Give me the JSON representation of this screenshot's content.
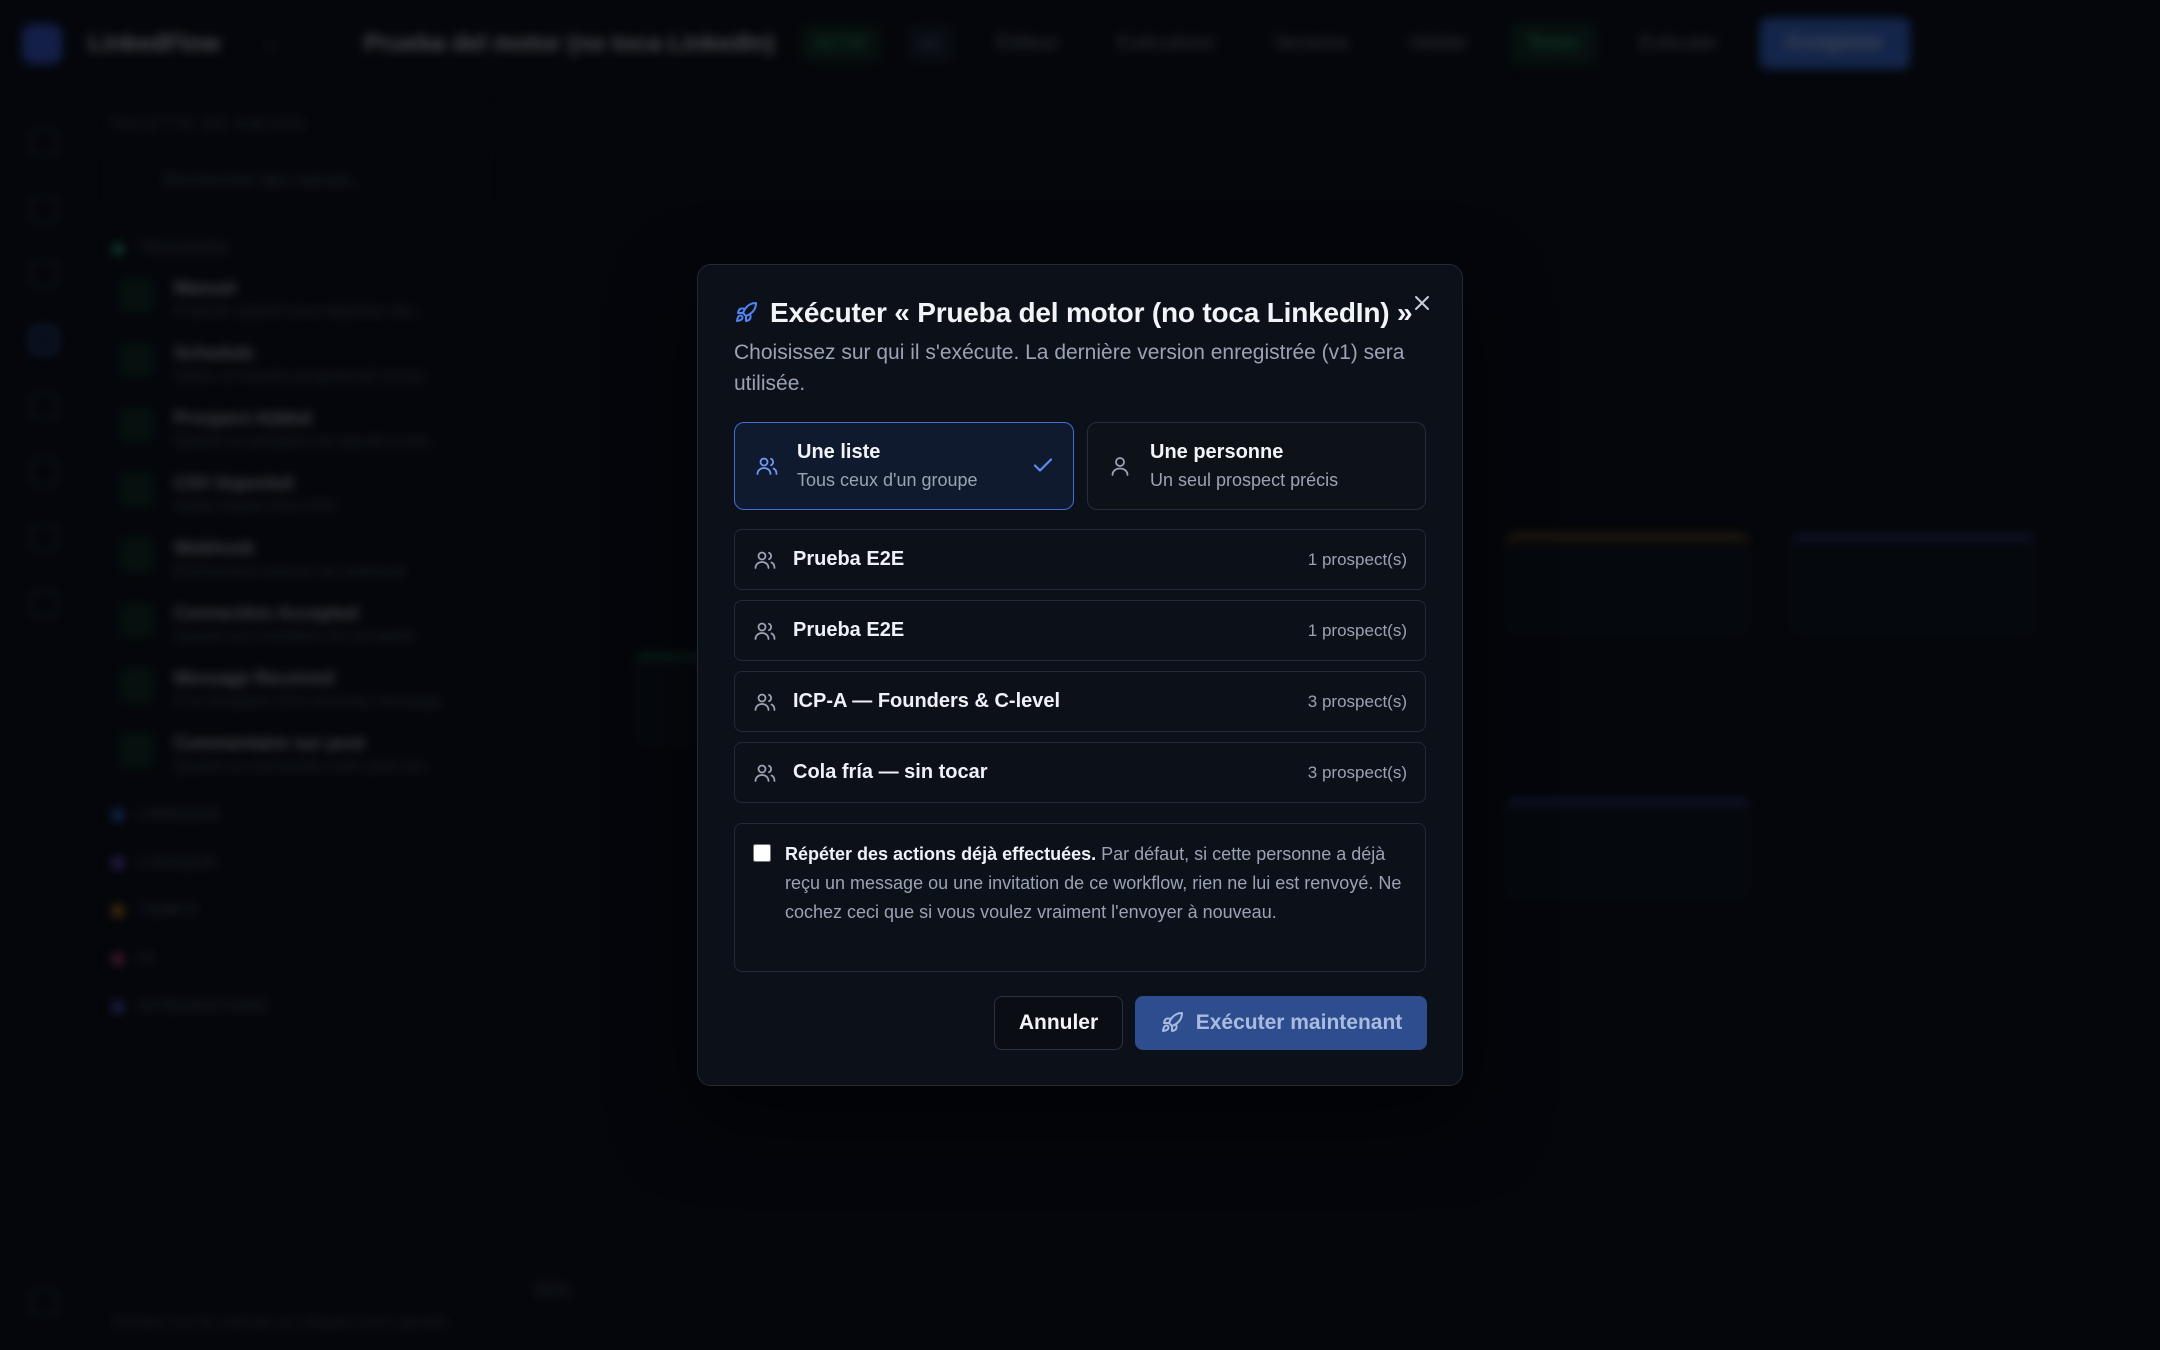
{
  "app": {
    "brand": "LinkedFlow",
    "workflow_title": "Prueba del motor (no toca LinkedIn)",
    "status_badge": "ACTIF",
    "version_badge": "v1",
    "toolbar": [
      "Éditeur",
      "Exécutions",
      "Versions",
      "Valider",
      "Tester",
      "Exécuter",
      "Enregistrer"
    ],
    "palette_heading": "PALETTE DE NŒUDS",
    "palette_search_placeholder": "Rechercher des nœuds...",
    "palette_categories": [
      {
        "label": "TRIGGERS",
        "color": "#2fbf71"
      },
      {
        "label": "LINKEDIN",
        "color": "#3b82f6"
      },
      {
        "label": "LOGIQUE",
        "color": "#8b5cf6"
      },
      {
        "label": "TEMPS",
        "color": "#f59e0b"
      },
      {
        "label": "IA",
        "color": "#ec4899"
      },
      {
        "label": "INTÉGRATIONS",
        "color": "#6366f1"
      }
    ],
    "trigger_nodes": [
      {
        "title": "Manuel",
        "desc": "À lancer quand vous déposez des..."
      },
      {
        "title": "Schedule",
        "desc": "Selon un horaire programmé (cron)"
      },
      {
        "title": "Prospect Added",
        "desc": "Quand un prospect est ajouté à une..."
      },
      {
        "title": "CSV Imported",
        "desc": "Après import d'un CSV"
      },
      {
        "title": "Webhook",
        "desc": "Événement externe via webhook"
      },
      {
        "title": "Connection Accepted",
        "desc": "Quand une invitation est acceptée"
      },
      {
        "title": "Message Received",
        "desc": "À la réception d'un nouveau message"
      },
      {
        "title": "Commentaire sur post",
        "desc": "Quand un commente votre post sur..."
      }
    ],
    "canvas_zoom": "60%",
    "canvas_hint": "Glissez sur le canvas ou cliquez pour ajouter"
  },
  "modal": {
    "title": "Exécuter « Prueba del motor (no toca LinkedIn) »",
    "subtitle": "Choisissez sur qui il s'exécute. La dernière version enregistrée (v1) sera utilisée.",
    "target_options": [
      {
        "title": "Une liste",
        "desc": "Tous ceux d'un groupe",
        "selected": true
      },
      {
        "title": "Une personne",
        "desc": "Un seul prospect précis",
        "selected": false
      }
    ],
    "lists": [
      {
        "name": "Prueba E2E",
        "count": "1 prospect(s)"
      },
      {
        "name": "Prueba E2E",
        "count": "1 prospect(s)"
      },
      {
        "name": "ICP-A — Founders & C-level",
        "count": "3 prospect(s)"
      },
      {
        "name": "Cola fría — sin tocar",
        "count": "3 prospect(s)"
      }
    ],
    "repeat": {
      "checked": false,
      "bold": "Répéter des actions déjà effectuées.",
      "text": " Par défaut, si cette personne a déjà reçu un message ou une invitation de ce workflow, rien ne lui est renvoyé. Ne cochez ceci que si vous voulez vraiment l'envoyer à nouveau."
    },
    "cancel_label": "Annuler",
    "run_label": "Exécuter maintenant"
  },
  "colors": {
    "accent": "#3e6fd8",
    "run_button": "#2d4d8e",
    "background": "#06080d"
  }
}
